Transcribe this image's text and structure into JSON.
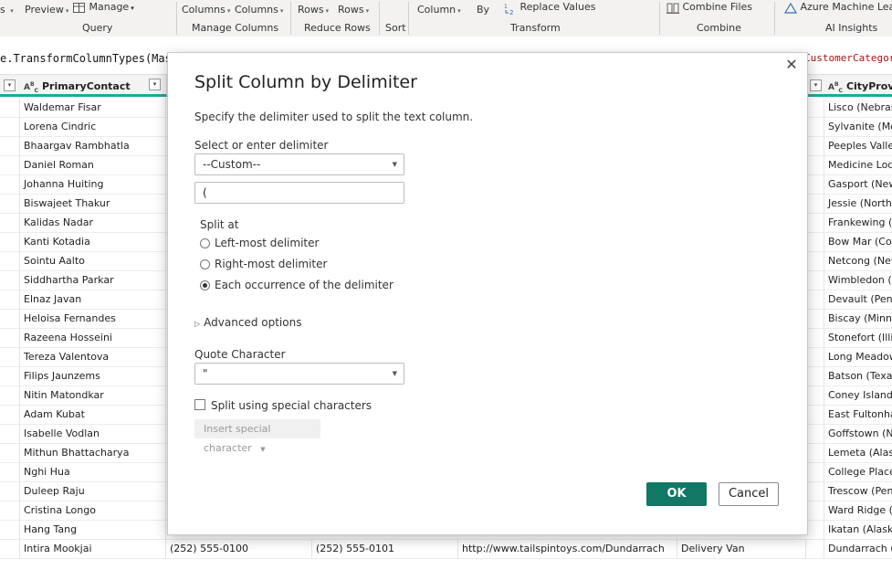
{
  "ribbon": {
    "groups": [
      {
        "name": "query",
        "label": "Query"
      },
      {
        "name": "manage-columns",
        "label": "Manage Columns"
      },
      {
        "name": "reduce-rows",
        "label": "Reduce Rows"
      },
      {
        "name": "sort",
        "label": "Sort"
      },
      {
        "name": "transform",
        "label": "Transform"
      },
      {
        "name": "combine",
        "label": "Combine"
      },
      {
        "name": "ai-insights",
        "label": "AI Insights"
      }
    ],
    "buttons": {
      "preview_label": "Preview",
      "manage_label": "Manage",
      "choose_columns_label": "Columns",
      "remove_columns_label": "Columns",
      "keep_rows_label": "Rows",
      "remove_rows_label": "Rows",
      "split_column_label": "Column",
      "group_by_label": "By",
      "replace_values_label": "Replace Values",
      "combine_files_label": "Combine Files",
      "azure_ml_label": "Azure Machine Lea"
    },
    "colors": {
      "accent": "#117865",
      "header_underline": "#1fa89b"
    }
  },
  "formula": {
    "left_text": "e.TransformColumnTypes(Maste",
    "right_text": "CustomerCategor"
  },
  "grid": {
    "columns": {
      "primary_contact": "PrimaryContact",
      "city_province": "CityProvin"
    },
    "rows": [
      {
        "contact": "Waldemar Fisar",
        "city": "Lisco (Nebrask"
      },
      {
        "contact": "Lorena Cindric",
        "city": "Sylvanite (Mor"
      },
      {
        "contact": "Bhaargav Rambhatla",
        "city": "Peeples Valley"
      },
      {
        "contact": "Daniel Roman",
        "city": "Medicine Lodg"
      },
      {
        "contact": "Johanna Huiting",
        "city": "Gasport (New"
      },
      {
        "contact": "Biswajeet Thakur",
        "city": "Jessie (North D"
      },
      {
        "contact": "Kalidas Nadar",
        "city": "Frankewing (Te"
      },
      {
        "contact": "Kanti Kotadia",
        "city": "Bow Mar (Colc"
      },
      {
        "contact": "Sointu Aalto",
        "city": "Netcong (New"
      },
      {
        "contact": "Siddhartha Parkar",
        "city": "Wimbledon (N"
      },
      {
        "contact": "Elnaz Javan",
        "city": "Devault (Penns"
      },
      {
        "contact": "Heloisa Fernandes",
        "city": "Biscay (Minnes"
      },
      {
        "contact": "Razeena Hosseini",
        "city": "Stonefort (Illin"
      },
      {
        "contact": "Tereza Valentova",
        "city": "Long Meadow"
      },
      {
        "contact": "Filips Jaunzems",
        "city": "Batson (Texas)"
      },
      {
        "contact": "Nitin Matondkar",
        "city": "Coney Island (N"
      },
      {
        "contact": "Adam Kubat",
        "city": "East Fultonhan"
      },
      {
        "contact": "Isabelle Vodlan",
        "city": "Goffstown (Ne"
      },
      {
        "contact": "Mithun Bhattacharya",
        "city": "Lemeta (Alaska"
      },
      {
        "contact": "Nghi Hua",
        "city": "College Place ("
      },
      {
        "contact": "Duleep Raju",
        "city": "Trescow (Penn"
      },
      {
        "contact": "Cristina Longo",
        "city": "Ward Ridge (Fl"
      },
      {
        "contact": "Hang Tang",
        "city": "Ikatan (Alaska)"
      }
    ],
    "last_row": {
      "contact": "Intira Mookjai",
      "phone": "(252) 555-0100",
      "fax": "(252) 555-0101",
      "website": "http://www.tailspintoys.com/Dundarrach",
      "delivery": "Delivery Van",
      "city": "Dundarrach (N"
    }
  },
  "dialog": {
    "title": "Split Column by Delimiter",
    "description": "Specify the delimiter used to split the text column.",
    "delimiter_label": "Select or enter delimiter",
    "delimiter_selected": "--Custom--",
    "delimiter_value": "(",
    "split_at_label": "Split at",
    "split_options": [
      {
        "label": "Left-most delimiter",
        "selected": false
      },
      {
        "label": "Right-most delimiter",
        "selected": false
      },
      {
        "label": "Each occurrence of the delimiter",
        "selected": true
      }
    ],
    "advanced_label": "Advanced options",
    "quote_label": "Quote Character",
    "quote_selected": "\"",
    "special_chars_label": "Split using special characters",
    "insert_special_label": "Insert special character",
    "ok_label": "OK",
    "cancel_label": "Cancel",
    "close_glyph": "✕"
  }
}
